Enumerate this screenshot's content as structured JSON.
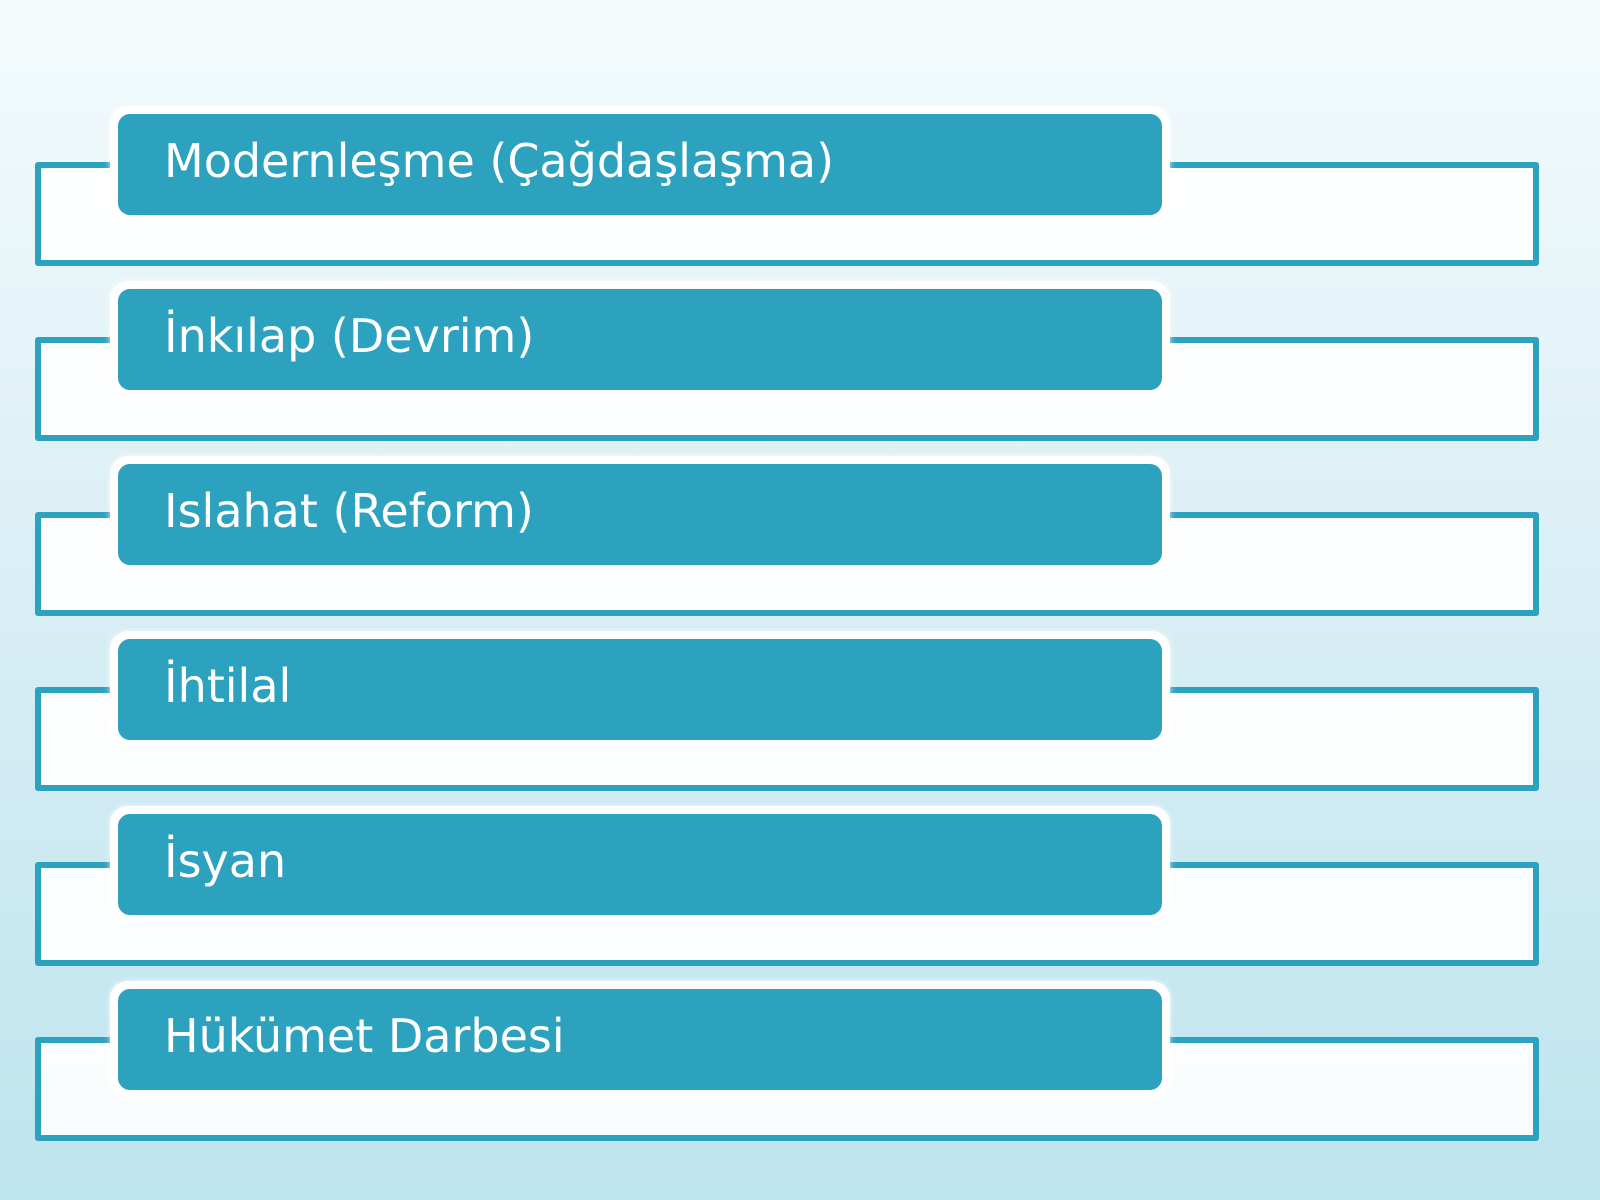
{
  "items": [
    {
      "label": "Modernleşme (Çağdaşlaşma)"
    },
    {
      "label": "İnkılap (Devrim)"
    },
    {
      "label": "Islahat (Reform)"
    },
    {
      "label": "İhtilal"
    },
    {
      "label": "İsyan"
    },
    {
      "label": "Hükümet Darbesi"
    }
  ],
  "colors": {
    "accent": "#2da2bf",
    "label_text": "#ffffff",
    "frame_fill": "#ffffff",
    "background_top": "#f4fbfd",
    "background_bottom": "#bee4ee"
  }
}
